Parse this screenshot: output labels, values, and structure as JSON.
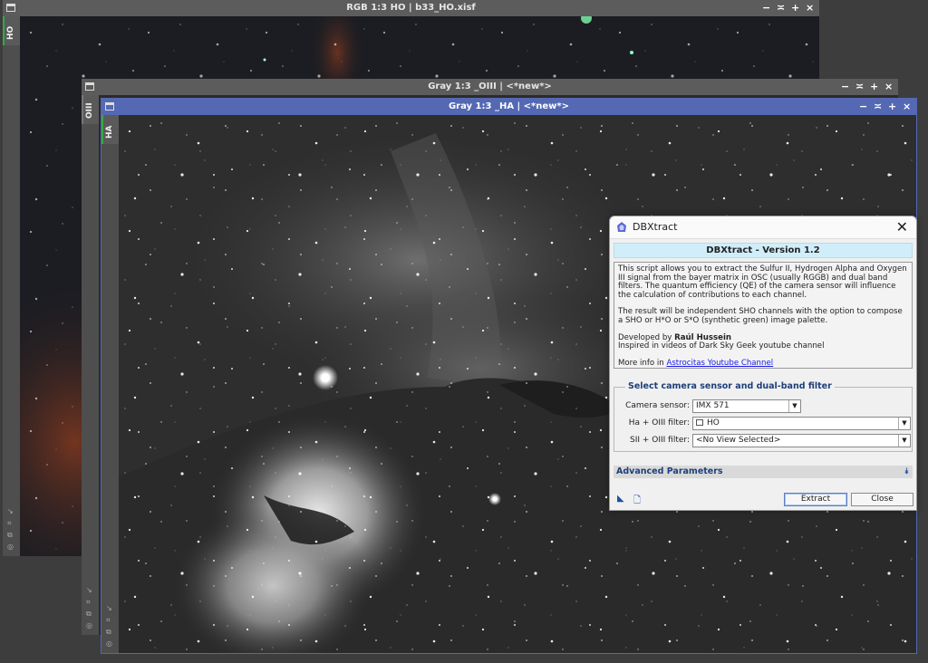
{
  "windows": {
    "rgb": {
      "title": "RGB 1:3 HO | b33_HO.xisf",
      "tab": "HO"
    },
    "oiii": {
      "title": "Gray 1:3 _OIII | <*new*>",
      "tab": "OIII"
    },
    "ha": {
      "title": "Gray 1:3 _HA | <*new*>",
      "tab": "HA"
    }
  },
  "titlebar_buttons": [
    "−",
    "≍",
    "+",
    "×"
  ],
  "dialog": {
    "title": "DBXtract",
    "close_glyph": "✕",
    "version": "DBXtract - Version 1.2",
    "info": {
      "p1": "This script allows you to extract the Sulfur II, Hydrogen Alpha and Oxygen III signal from the bayer matrix in OSC (usually RGGB) and dual band filters. The quantum efficiency (QE) of the camera sensor will influence the calculation of contributions to each channel.",
      "p2": "The result will be independent SHO channels with the option to compose a SHO or H*O or S*O (synthetic green) image palette.",
      "developed_prefix": "Developed by ",
      "developer": "Raúl Hussein",
      "inspired": "Inspired in videos of Dark Sky Geek youtube channel",
      "more_prefix": "More info in ",
      "link": "Astrocitas Youtube Channel"
    },
    "group": {
      "title": "Select camera sensor and dual-band filter",
      "camera_label": "Camera sensor:",
      "camera_value": "IMX 571",
      "ha_label": "Ha + OIII filter:",
      "ha_value": "HO",
      "sii_label": "SII + OIII filter:",
      "sii_value": "<No View Selected>"
    },
    "advanced": "Advanced Parameters",
    "extract": "Extract",
    "close": "Close"
  },
  "colors": {
    "active_titlebar": "#5468b4",
    "inactive_titlebar": "#5c5c5c",
    "tab_marker": "#33aa44"
  }
}
